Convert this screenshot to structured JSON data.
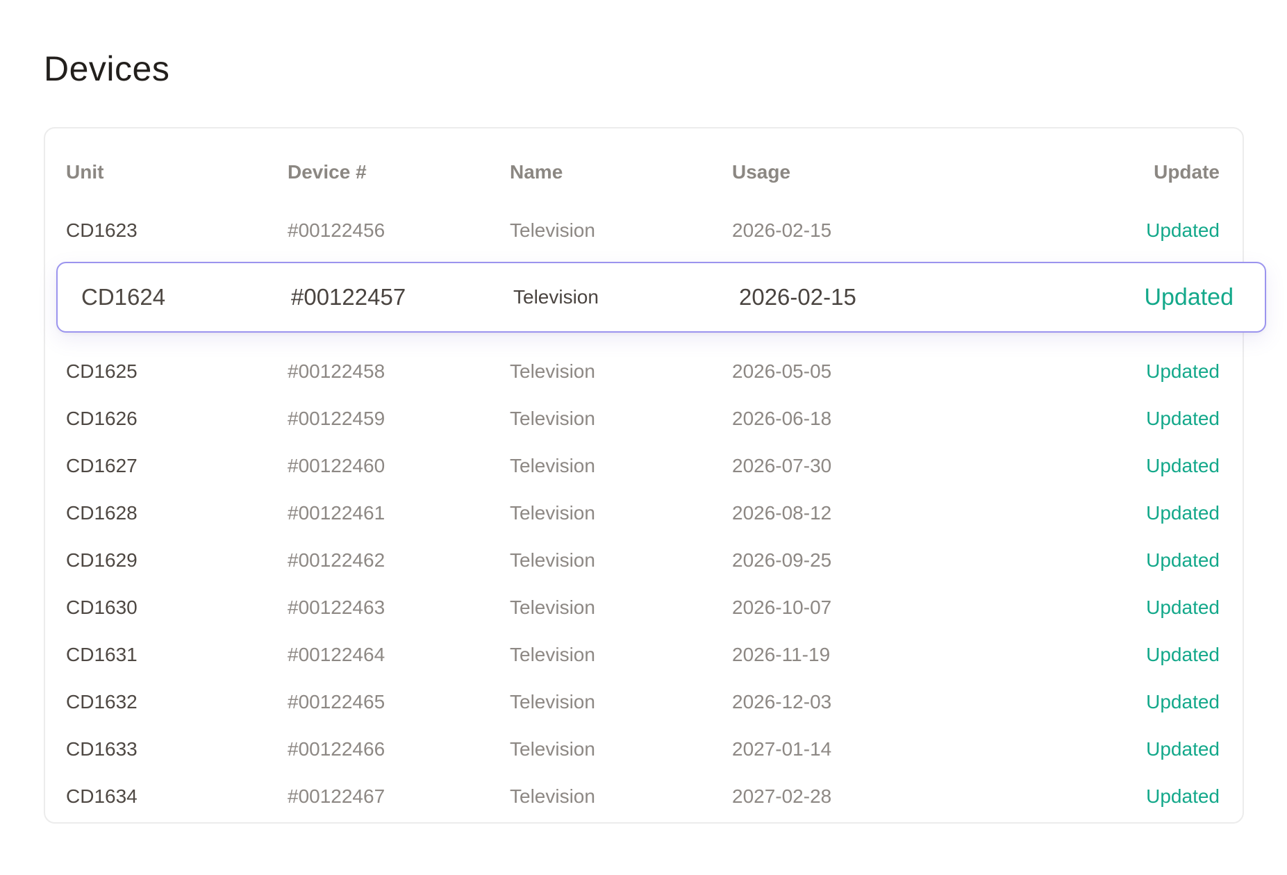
{
  "page": {
    "title": "Devices"
  },
  "table": {
    "headers": {
      "unit": "Unit",
      "device": "Device #",
      "name": "Name",
      "usage": "Usage",
      "update": "Update"
    },
    "rows": [
      {
        "unit": "CD1623",
        "device": "#00122456",
        "name": "Television",
        "usage": "2026-02-15",
        "update": "Updated"
      },
      {
        "unit": "CD1624",
        "device": "#00122457",
        "name": "Television",
        "usage": "2026-02-15",
        "update": "Updated"
      },
      {
        "unit": "CD1625",
        "device": "#00122458",
        "name": "Television",
        "usage": "2026-05-05",
        "update": "Updated"
      },
      {
        "unit": "CD1626",
        "device": "#00122459",
        "name": "Television",
        "usage": "2026-06-18",
        "update": "Updated"
      },
      {
        "unit": "CD1627",
        "device": "#00122460",
        "name": "Television",
        "usage": "2026-07-30",
        "update": "Updated"
      },
      {
        "unit": "CD1628",
        "device": "#00122461",
        "name": "Television",
        "usage": "2026-08-12",
        "update": "Updated"
      },
      {
        "unit": "CD1629",
        "device": "#00122462",
        "name": "Television",
        "usage": "2026-09-25",
        "update": "Updated"
      },
      {
        "unit": "CD1630",
        "device": "#00122463",
        "name": "Television",
        "usage": "2026-10-07",
        "update": "Updated"
      },
      {
        "unit": "CD1631",
        "device": "#00122464",
        "name": "Television",
        "usage": "2026-11-19",
        "update": "Updated"
      },
      {
        "unit": "CD1632",
        "device": "#00122465",
        "name": "Television",
        "usage": "2026-12-03",
        "update": "Updated"
      },
      {
        "unit": "CD1633",
        "device": "#00122466",
        "name": "Television",
        "usage": "2027-01-14",
        "update": "Updated"
      },
      {
        "unit": "CD1634",
        "device": "#00122467",
        "name": "Television",
        "usage": "2027-02-28",
        "update": "Updated"
      }
    ]
  },
  "colors": {
    "status_updated": "#13a88a",
    "selection_border": "#9b94ee"
  }
}
